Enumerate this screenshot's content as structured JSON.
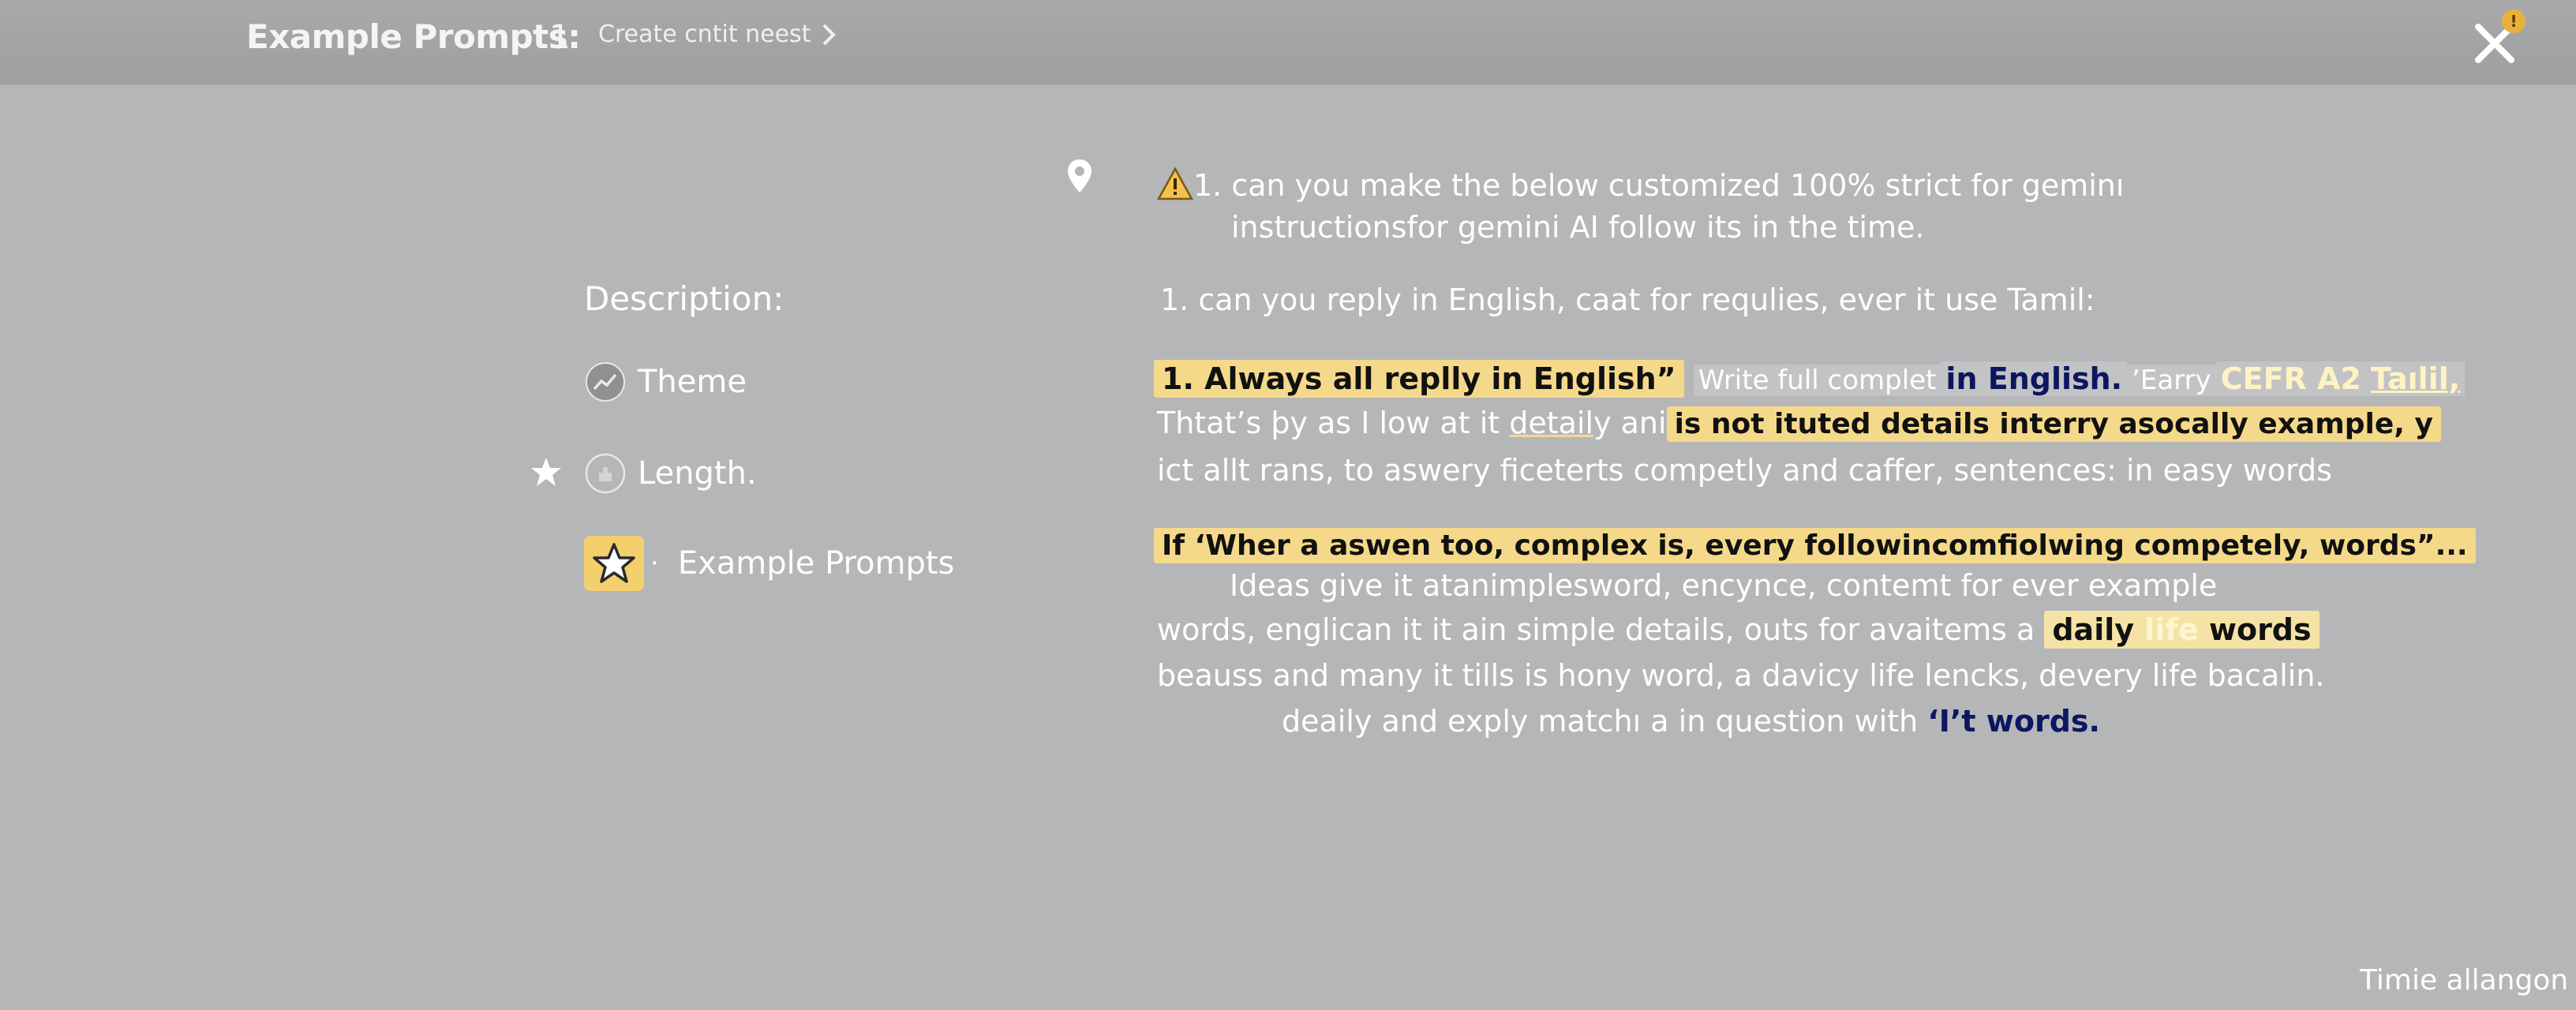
{
  "header": {
    "title": "Example Prompts:",
    "step": "1",
    "breadcrumb": "Create cntit neest",
    "notification_count": "!"
  },
  "sidebar": {
    "heading": "Description:",
    "items": [
      {
        "label": "Theme",
        "icon": "trend-icon"
      },
      {
        "label": "Length.",
        "icon": "length-icon"
      },
      {
        "label": "Example Prompts",
        "icon": "star-icon"
      }
    ]
  },
  "content": {
    "intro_line1": "1. can you make the below customized 100% strict for geminı",
    "intro_line2": "instructionsfor gemini AI follow its in the time.",
    "line3": "1. can you reply in English,  caat for requlies, ever it use Tamil:",
    "row4": {
      "hl1": "1.  Always all replly in English”",
      "mid": "Write full complet",
      "navy": "in English.",
      "after": "’Earry",
      "gold1": "CEFR  A2",
      "gold2": "Taılil,"
    },
    "row5": {
      "pre": "Thtat’s þy as I low at it",
      "underlined": "detail",
      "mid": "y ani",
      "hl": "is not ituted details interry asocally example, y"
    },
    "row6": "ict allt rans, to aswery ficeterts competly and caffer, sentences:  in easy words",
    "row7_hl": "If ‘Wher a aswen too, complex is, every followincomfiolwing competely, words”...",
    "row8": "Ideas give it atanimplesword, encynce, contemt for ever example",
    "row9": {
      "pre": "words, englican it it ain simple details, outs for avaitems a",
      "hl_a": "daily",
      "hl_b": "life",
      "hl_c": "words"
    },
    "row10": "beauss and many it tills is hony word, a davicy life lencks, devery life bacalin.",
    "row11": {
      "pre": "deaily and exply matchı a in question with",
      "navy": "‘I’t words."
    }
  },
  "footer": {
    "label": "Timie allangon"
  }
}
